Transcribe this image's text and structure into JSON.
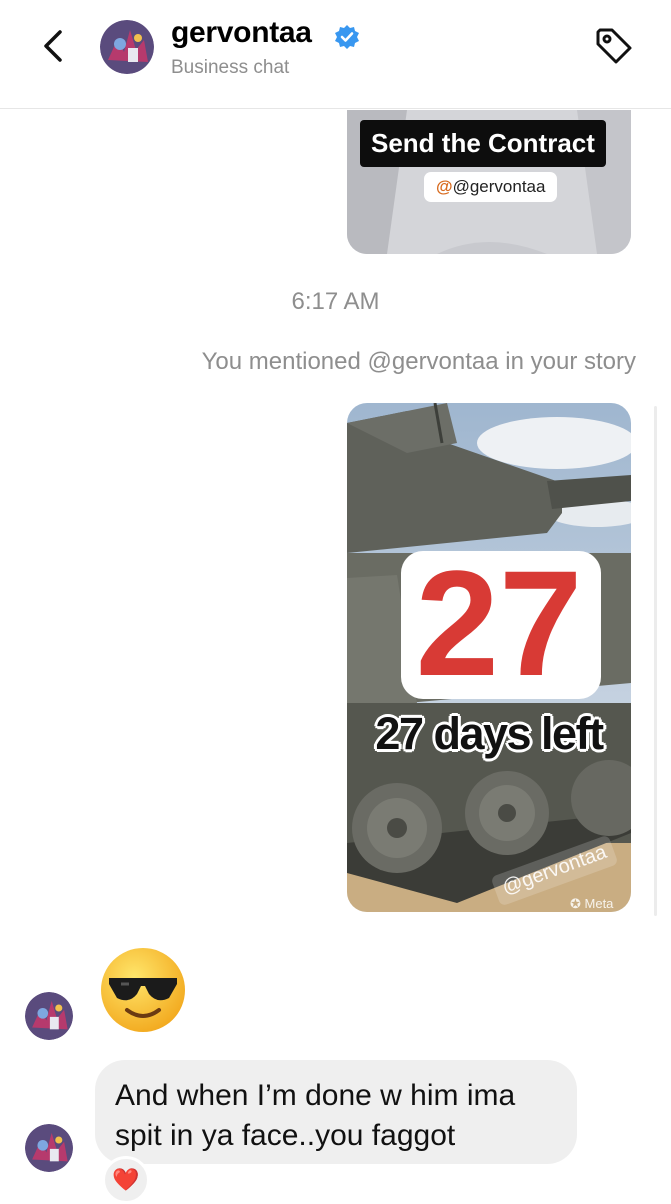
{
  "header": {
    "back_icon": "chevron-left-icon",
    "username": "gervontaa",
    "verified_icon": "verified-badge-icon",
    "subtitle": "Business chat",
    "tag_icon": "tag-icon"
  },
  "story_share_top": {
    "label": "Send the Contract",
    "mention_tag": "@gervontaa"
  },
  "timestamp": "6:17 AM",
  "story_mention": {
    "note": "You mentioned @gervontaa in your story",
    "number_text": "27",
    "caption": "27 days left",
    "watermark": "@gervontaa",
    "brand_mark": "Meta"
  },
  "messages": [
    {
      "type": "emoji",
      "emoji": "smiling-face-with-sunglasses"
    },
    {
      "type": "text",
      "text": "And when I’m done w him ima spit in ya face..you faggot",
      "reaction": "❤️"
    }
  ],
  "colors": {
    "secondary_text": "#8e8e8e",
    "bubble": "#efefef",
    "verified": "#3897f0"
  }
}
